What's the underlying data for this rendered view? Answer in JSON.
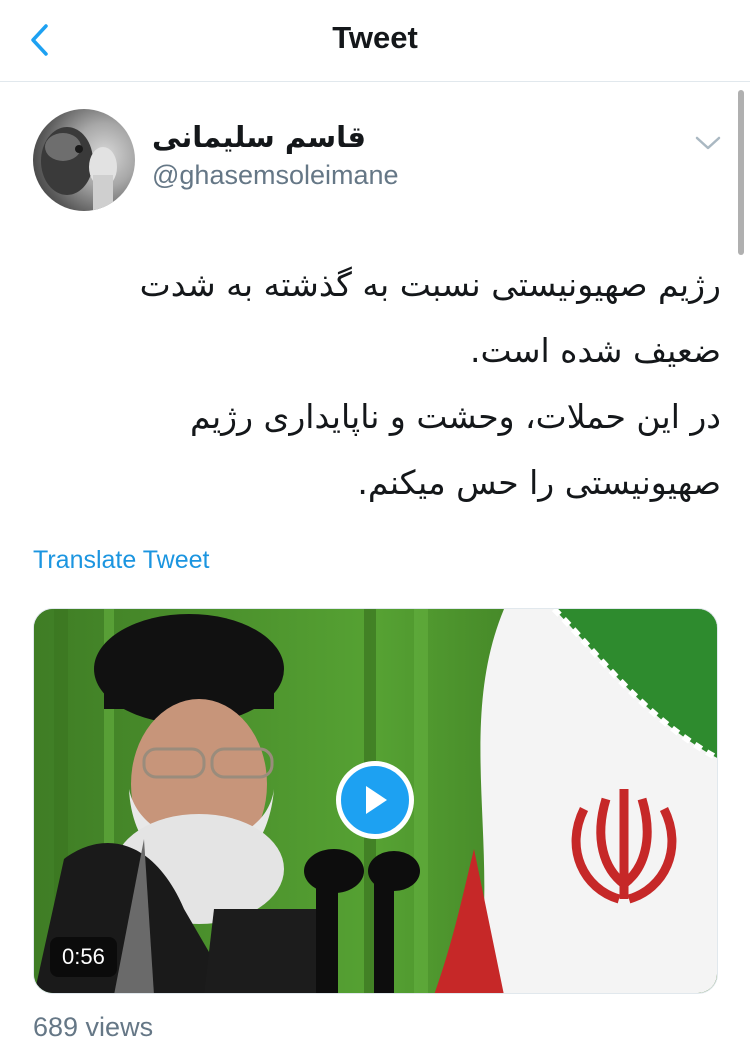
{
  "navbar": {
    "title": "Tweet",
    "back_icon": "chevron-left-icon",
    "accent_color": "#1da1f2"
  },
  "tweet": {
    "author": {
      "display_name": "قاسم سلیمانی",
      "handle": "@ghasemsoleimane"
    },
    "more_icon": "chevron-down-icon",
    "text_lines": [
      "رژیم صهیونیستی نسبت به گذشته به شدت",
      "ضعیف شده است.",
      "در این حملات، وحشت و ناپایداری رژیم",
      "صهیونیستی را حس میکنم."
    ],
    "translate_label": "Translate Tweet",
    "media": {
      "type": "video",
      "duration": "0:56",
      "play_icon": "play-icon"
    },
    "views": "689 views"
  }
}
